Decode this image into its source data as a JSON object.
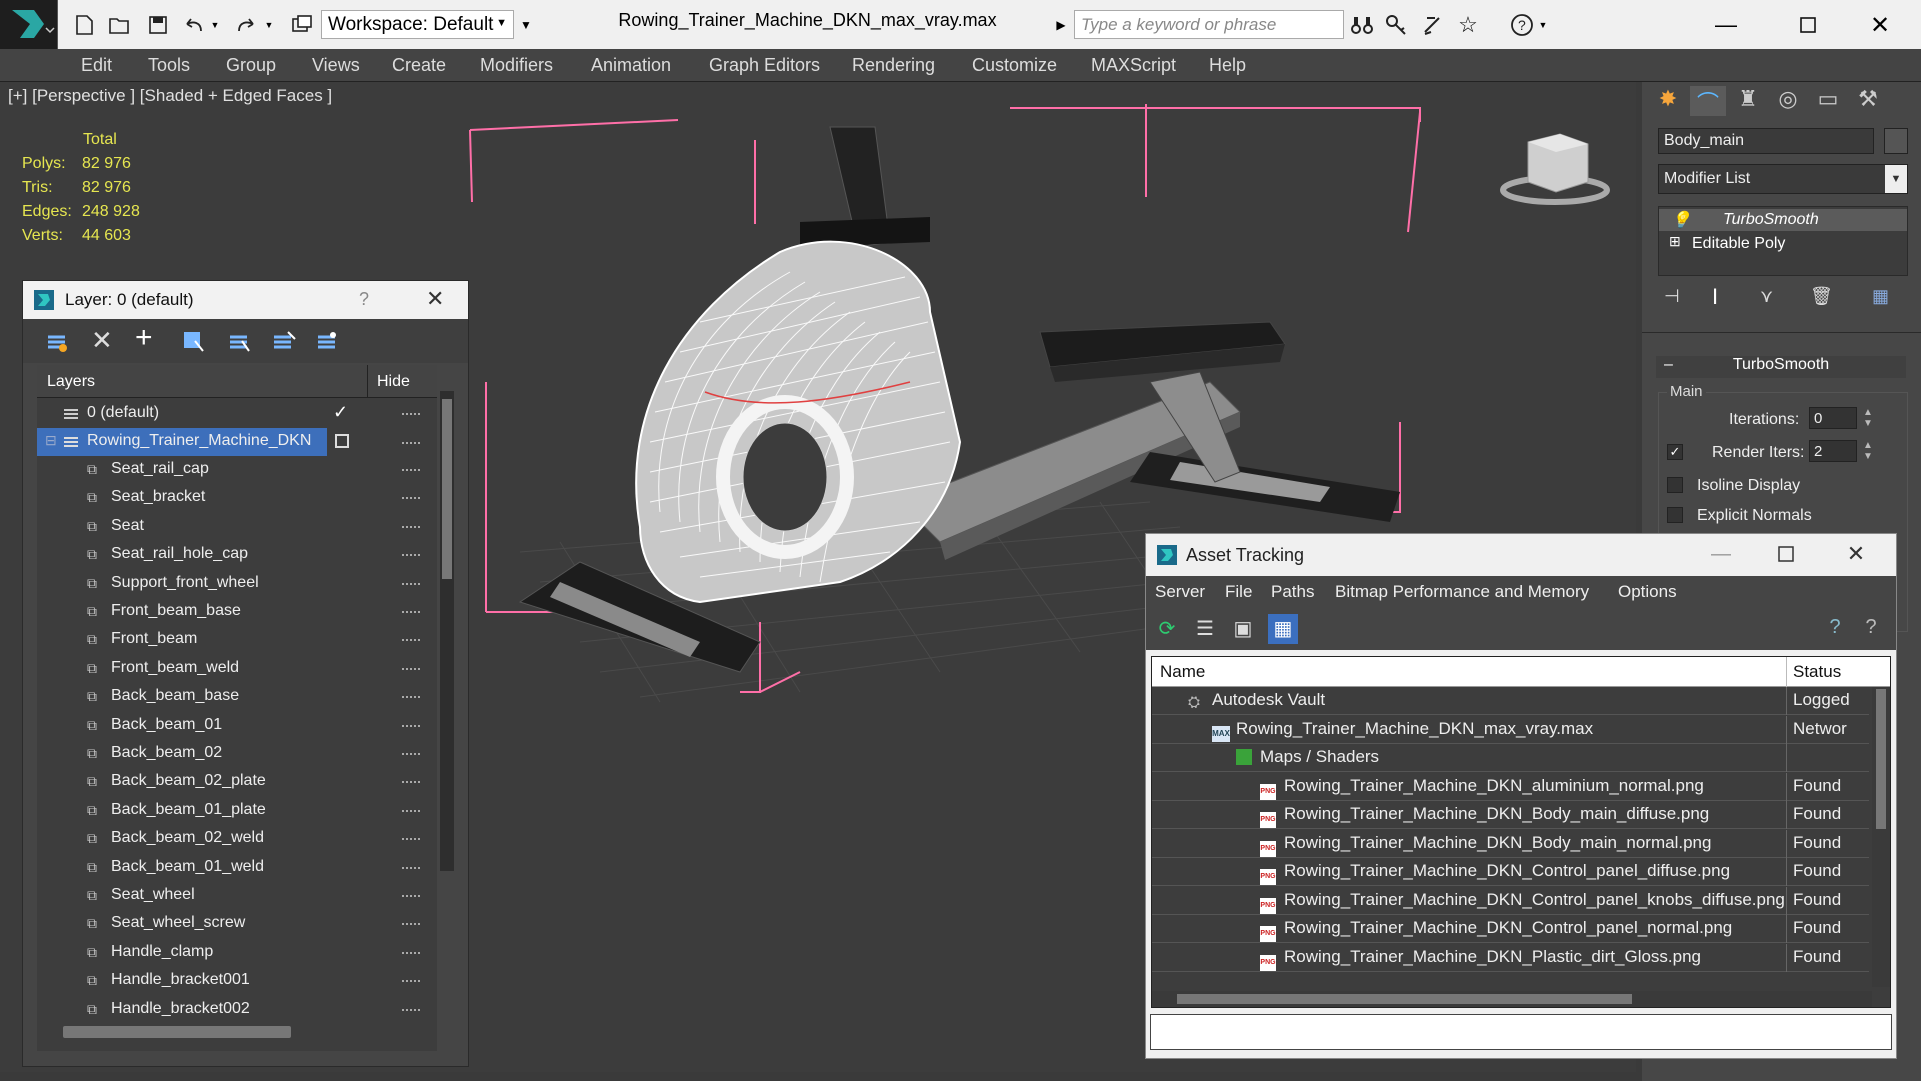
{
  "app": {
    "title": "Rowing_Trainer_Machine_DKN_max_vray.max",
    "workspace": "Workspace: Default",
    "search_placeholder": "Type a keyword or phrase"
  },
  "menu": [
    "Edit",
    "Tools",
    "Group",
    "Views",
    "Create",
    "Modifiers",
    "Animation",
    "Graph Editors",
    "Rendering",
    "Customize",
    "MAXScript",
    "Help"
  ],
  "viewport": {
    "label": "[+] [Perspective ] [Shaded + Edged Faces ]",
    "stats": {
      "header": "Total",
      "polys_label": "Polys:",
      "polys": "82 976",
      "tris_label": "Tris:",
      "tris": "82 976",
      "edges_label": "Edges:",
      "edges": "248 928",
      "verts_label": "Verts:",
      "verts": "44 603"
    }
  },
  "layer_panel": {
    "title": "Layer: 0 (default)",
    "help": "?",
    "col_layers": "Layers",
    "col_hide": "Hide",
    "default_layer": "0 (default)",
    "group_layer": "Rowing_Trainer_Machine_DKN",
    "objects": [
      "Seat_rail_cap",
      "Seat_bracket",
      "Seat",
      "Seat_rail_hole_cap",
      "Support_front_wheel",
      "Front_beam_base",
      "Front_beam",
      "Front_beam_weld",
      "Back_beam_base",
      "Back_beam_01",
      "Back_beam_02",
      "Back_beam_02_plate",
      "Back_beam_01_plate",
      "Back_beam_02_weld",
      "Back_beam_01_weld",
      "Seat_wheel",
      "Seat_wheel_screw",
      "Handle_clamp",
      "Handle_bracket001",
      "Handle_bracket002"
    ]
  },
  "command_panel": {
    "object_name": "Body_main",
    "modifier_list": "Modifier List",
    "stack": [
      "TurboSmooth",
      "Editable Poly"
    ],
    "rollout_title": "TurboSmooth",
    "group_main": "Main",
    "iterations_label": "Iterations:",
    "iterations": "0",
    "render_iters_label": "Render Iters:",
    "render_iters": "2",
    "isoline": "Isoline Display",
    "explicit": "Explicit Normals"
  },
  "asset_tracking": {
    "title": "Asset Tracking",
    "menu": [
      "Server",
      "File",
      "Paths",
      "Bitmap Performance and Memory",
      "Options"
    ],
    "col_name": "Name",
    "col_status": "Status",
    "rows": [
      {
        "name": "Autodesk Vault",
        "status": "Logged",
        "indent": 0,
        "icon": "vault-icon"
      },
      {
        "name": "Rowing_Trainer_Machine_DKN_max_vray.max",
        "status": "Networ",
        "indent": 1,
        "icon": "max-file-icon"
      },
      {
        "name": "Maps / Shaders",
        "status": "",
        "indent": 2,
        "icon": "maps-icon"
      },
      {
        "name": "Rowing_Trainer_Machine_DKN_aluminium_normal.png",
        "status": "Found",
        "indent": 3,
        "icon": "png-icon"
      },
      {
        "name": "Rowing_Trainer_Machine_DKN_Body_main_diffuse.png",
        "status": "Found",
        "indent": 3,
        "icon": "png-icon"
      },
      {
        "name": "Rowing_Trainer_Machine_DKN_Body_main_normal.png",
        "status": "Found",
        "indent": 3,
        "icon": "png-icon"
      },
      {
        "name": "Rowing_Trainer_Machine_DKN_Control_panel_diffuse.png",
        "status": "Found",
        "indent": 3,
        "icon": "png-icon"
      },
      {
        "name": "Rowing_Trainer_Machine_DKN_Control_panel_knobs_diffuse.png",
        "status": "Found",
        "indent": 3,
        "icon": "png-icon"
      },
      {
        "name": "Rowing_Trainer_Machine_DKN_Control_panel_normal.png",
        "status": "Found",
        "indent": 3,
        "icon": "png-icon"
      },
      {
        "name": "Rowing_Trainer_Machine_DKN_Plastic_dirt_Gloss.png",
        "status": "Found",
        "indent": 3,
        "icon": "png-icon"
      }
    ]
  }
}
